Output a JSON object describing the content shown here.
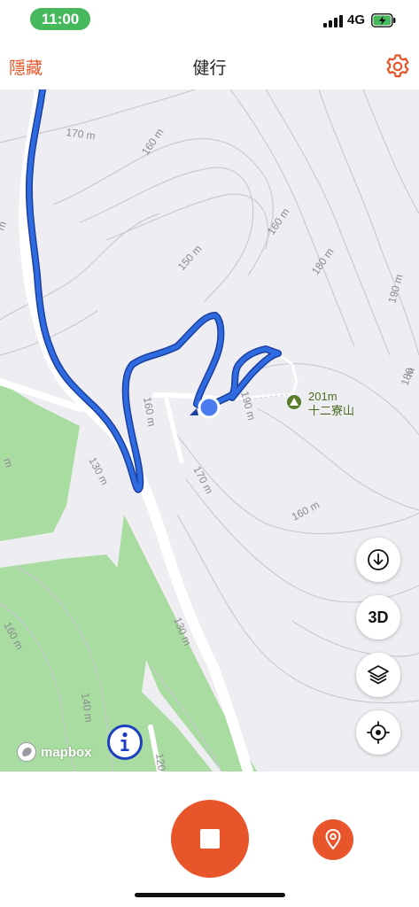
{
  "status_bar": {
    "time": "11:00",
    "network": "4G"
  },
  "nav": {
    "left_label": "隱藏",
    "title": "健行",
    "right_icon": "gear-icon"
  },
  "map": {
    "contour_labels": [
      "170 m",
      "160 m",
      "160 m",
      "150 m",
      "180 m",
      "190 m",
      "180",
      "160 m",
      "190 m",
      "170 m",
      "130 m",
      "160 m",
      "130 m",
      "160 m",
      "140 m",
      "120",
      "m",
      "m",
      "m"
    ],
    "peak": {
      "elevation": "201m",
      "name": "十二寮山"
    },
    "attribution": "mapbox"
  },
  "map_controls": {
    "download_icon": "download-icon",
    "three_d_label": "3D",
    "layers_icon": "layers-icon",
    "locate_icon": "locate-icon"
  },
  "bottom": {
    "stop_icon": "stop-icon",
    "waypoint_icon": "location-pin-icon"
  },
  "colors": {
    "accent": "#e8552a",
    "track": "#2b63d9",
    "status_green": "#46b95c",
    "forest": "#a9dca0"
  }
}
